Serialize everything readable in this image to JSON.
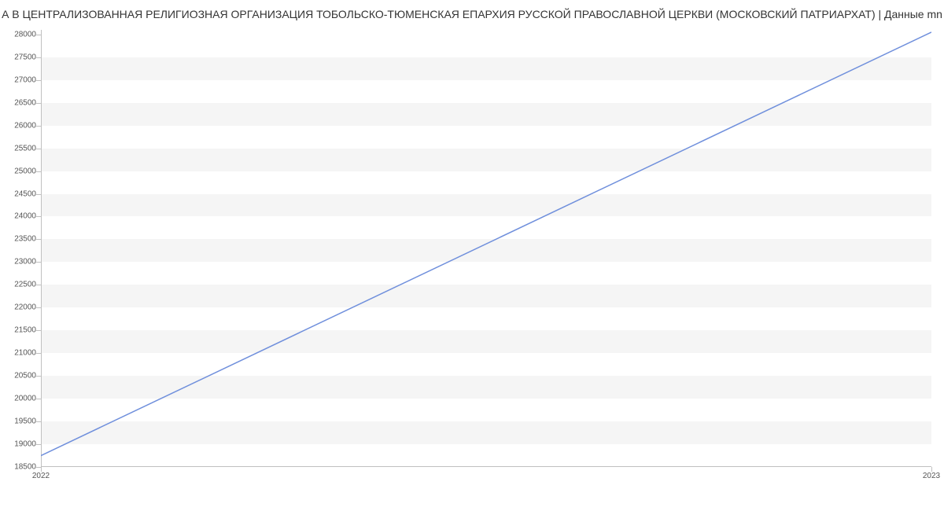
{
  "chart_data": {
    "type": "line",
    "title": "А В ЦЕНТРАЛИЗОВАННАЯ РЕЛИГИОЗНАЯ ОРГАНИЗАЦИЯ ТОБОЛЬСКО-ТЮМЕНСКАЯ ЕПАРХИЯ РУССКОЙ ПРАВОСЛАВНОЙ ЦЕРКВИ (МОСКОВСКИЙ ПАТРИАРХАТ) | Данные mn",
    "categories": [
      "2022",
      "2023"
    ],
    "values": [
      18750,
      28050
    ],
    "xlabel": "",
    "ylabel": "",
    "ylim": [
      18500,
      28100
    ],
    "y_ticks": [
      18500,
      19000,
      19500,
      20000,
      20500,
      21000,
      21500,
      22000,
      22500,
      23000,
      23500,
      24000,
      24500,
      25000,
      25500,
      26000,
      26500,
      27000,
      27500,
      28000
    ],
    "line_color": "#6f8fdc"
  }
}
